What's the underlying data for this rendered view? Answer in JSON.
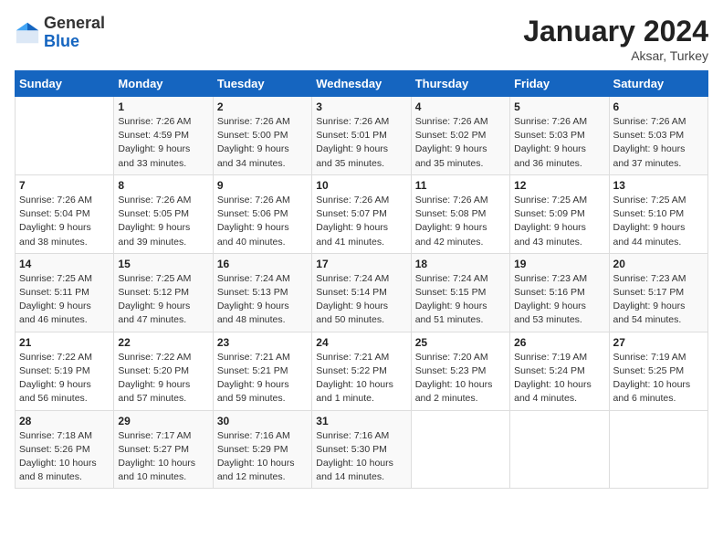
{
  "header": {
    "logo_general": "General",
    "logo_blue": "Blue",
    "month_title": "January 2024",
    "location": "Aksar, Turkey"
  },
  "weekdays": [
    "Sunday",
    "Monday",
    "Tuesday",
    "Wednesday",
    "Thursday",
    "Friday",
    "Saturday"
  ],
  "weeks": [
    [
      {
        "day": "",
        "detail": ""
      },
      {
        "day": "1",
        "detail": "Sunrise: 7:26 AM\nSunset: 4:59 PM\nDaylight: 9 hours\nand 33 minutes."
      },
      {
        "day": "2",
        "detail": "Sunrise: 7:26 AM\nSunset: 5:00 PM\nDaylight: 9 hours\nand 34 minutes."
      },
      {
        "day": "3",
        "detail": "Sunrise: 7:26 AM\nSunset: 5:01 PM\nDaylight: 9 hours\nand 35 minutes."
      },
      {
        "day": "4",
        "detail": "Sunrise: 7:26 AM\nSunset: 5:02 PM\nDaylight: 9 hours\nand 35 minutes."
      },
      {
        "day": "5",
        "detail": "Sunrise: 7:26 AM\nSunset: 5:03 PM\nDaylight: 9 hours\nand 36 minutes."
      },
      {
        "day": "6",
        "detail": "Sunrise: 7:26 AM\nSunset: 5:03 PM\nDaylight: 9 hours\nand 37 minutes."
      }
    ],
    [
      {
        "day": "7",
        "detail": "Sunrise: 7:26 AM\nSunset: 5:04 PM\nDaylight: 9 hours\nand 38 minutes."
      },
      {
        "day": "8",
        "detail": "Sunrise: 7:26 AM\nSunset: 5:05 PM\nDaylight: 9 hours\nand 39 minutes."
      },
      {
        "day": "9",
        "detail": "Sunrise: 7:26 AM\nSunset: 5:06 PM\nDaylight: 9 hours\nand 40 minutes."
      },
      {
        "day": "10",
        "detail": "Sunrise: 7:26 AM\nSunset: 5:07 PM\nDaylight: 9 hours\nand 41 minutes."
      },
      {
        "day": "11",
        "detail": "Sunrise: 7:26 AM\nSunset: 5:08 PM\nDaylight: 9 hours\nand 42 minutes."
      },
      {
        "day": "12",
        "detail": "Sunrise: 7:25 AM\nSunset: 5:09 PM\nDaylight: 9 hours\nand 43 minutes."
      },
      {
        "day": "13",
        "detail": "Sunrise: 7:25 AM\nSunset: 5:10 PM\nDaylight: 9 hours\nand 44 minutes."
      }
    ],
    [
      {
        "day": "14",
        "detail": "Sunrise: 7:25 AM\nSunset: 5:11 PM\nDaylight: 9 hours\nand 46 minutes."
      },
      {
        "day": "15",
        "detail": "Sunrise: 7:25 AM\nSunset: 5:12 PM\nDaylight: 9 hours\nand 47 minutes."
      },
      {
        "day": "16",
        "detail": "Sunrise: 7:24 AM\nSunset: 5:13 PM\nDaylight: 9 hours\nand 48 minutes."
      },
      {
        "day": "17",
        "detail": "Sunrise: 7:24 AM\nSunset: 5:14 PM\nDaylight: 9 hours\nand 50 minutes."
      },
      {
        "day": "18",
        "detail": "Sunrise: 7:24 AM\nSunset: 5:15 PM\nDaylight: 9 hours\nand 51 minutes."
      },
      {
        "day": "19",
        "detail": "Sunrise: 7:23 AM\nSunset: 5:16 PM\nDaylight: 9 hours\nand 53 minutes."
      },
      {
        "day": "20",
        "detail": "Sunrise: 7:23 AM\nSunset: 5:17 PM\nDaylight: 9 hours\nand 54 minutes."
      }
    ],
    [
      {
        "day": "21",
        "detail": "Sunrise: 7:22 AM\nSunset: 5:19 PM\nDaylight: 9 hours\nand 56 minutes."
      },
      {
        "day": "22",
        "detail": "Sunrise: 7:22 AM\nSunset: 5:20 PM\nDaylight: 9 hours\nand 57 minutes."
      },
      {
        "day": "23",
        "detail": "Sunrise: 7:21 AM\nSunset: 5:21 PM\nDaylight: 9 hours\nand 59 minutes."
      },
      {
        "day": "24",
        "detail": "Sunrise: 7:21 AM\nSunset: 5:22 PM\nDaylight: 10 hours\nand 1 minute."
      },
      {
        "day": "25",
        "detail": "Sunrise: 7:20 AM\nSunset: 5:23 PM\nDaylight: 10 hours\nand 2 minutes."
      },
      {
        "day": "26",
        "detail": "Sunrise: 7:19 AM\nSunset: 5:24 PM\nDaylight: 10 hours\nand 4 minutes."
      },
      {
        "day": "27",
        "detail": "Sunrise: 7:19 AM\nSunset: 5:25 PM\nDaylight: 10 hours\nand 6 minutes."
      }
    ],
    [
      {
        "day": "28",
        "detail": "Sunrise: 7:18 AM\nSunset: 5:26 PM\nDaylight: 10 hours\nand 8 minutes."
      },
      {
        "day": "29",
        "detail": "Sunrise: 7:17 AM\nSunset: 5:27 PM\nDaylight: 10 hours\nand 10 minutes."
      },
      {
        "day": "30",
        "detail": "Sunrise: 7:16 AM\nSunset: 5:29 PM\nDaylight: 10 hours\nand 12 minutes."
      },
      {
        "day": "31",
        "detail": "Sunrise: 7:16 AM\nSunset: 5:30 PM\nDaylight: 10 hours\nand 14 minutes."
      },
      {
        "day": "",
        "detail": ""
      },
      {
        "day": "",
        "detail": ""
      },
      {
        "day": "",
        "detail": ""
      }
    ]
  ]
}
